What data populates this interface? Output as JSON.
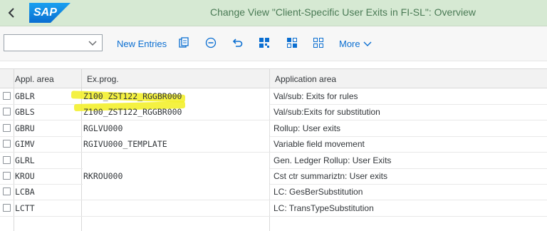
{
  "window": {
    "title": "Change View \"Client-Specific User Exits in FI-SL\": Overview",
    "logo_text": "SAP",
    "accent": "#0a6ed1",
    "titlebar_bg": "#d6e9d3"
  },
  "toolbar": {
    "select_value": "",
    "new_entries": "New Entries",
    "more": "More",
    "icons": [
      "copy-icon",
      "delete-icon",
      "undo-icon",
      "select-all-icon",
      "select-block-icon",
      "deselect-all-icon"
    ]
  },
  "table": {
    "columns": [
      "Appl. area",
      "Ex.prog.",
      "Application area"
    ],
    "rows": [
      {
        "area": "GBLR",
        "prog": "Z100_ZST122_RGGBR000",
        "desc": "Val/sub: Exits for rules"
      },
      {
        "area": "GBLS",
        "prog": "Z100_ZST122_RGGBR000",
        "desc": "Val/sub:Exits for substitution"
      },
      {
        "area": "GBRU",
        "prog": "RGLVU000",
        "desc": "Rollup: User exits"
      },
      {
        "area": "GIMV",
        "prog": "RGIVU000_TEMPLATE",
        "desc": "Variable field movement"
      },
      {
        "area": "GLRL",
        "prog": "",
        "desc": "Gen. Ledger Rollup: User Exits"
      },
      {
        "area": "KROU",
        "prog": "RKROU000",
        "desc": "Cst ctr summariztn: User exits"
      },
      {
        "area": "LCBA",
        "prog": "",
        "desc": "LC: GesBerSubstitution"
      },
      {
        "area": "LCTT",
        "prog": "",
        "desc": "LC: TransTypeSubstitution"
      }
    ]
  }
}
